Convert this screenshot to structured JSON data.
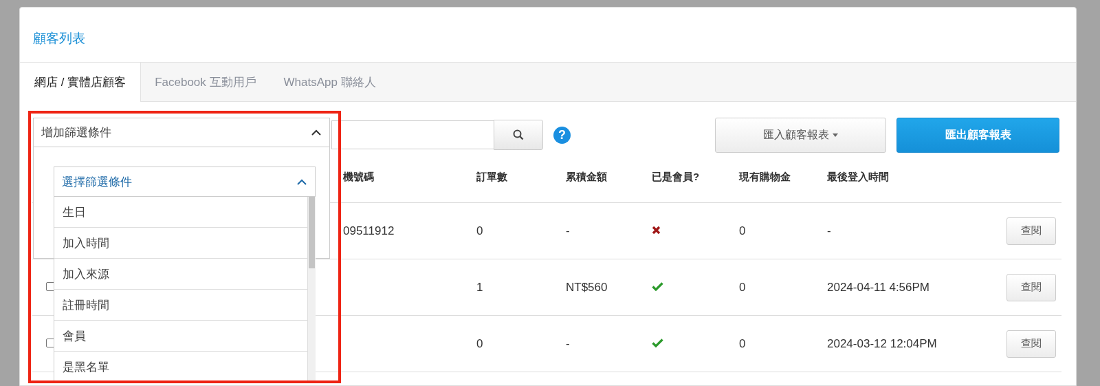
{
  "page_title": "顧客列表",
  "tabs": [
    {
      "label": "網店 / 實體店顧客",
      "selected": true
    },
    {
      "label": "Facebook 互動用戶",
      "selected": false
    },
    {
      "label": "WhatsApp 聯絡人",
      "selected": false
    }
  ],
  "help_icon": "?",
  "import_button": "匯入顧客報表",
  "export_button": "匯出顧客報表",
  "table": {
    "columns": [
      "機號碼",
      "訂單數",
      "累積金額",
      "已是會員?",
      "現有購物金",
      "最後登入時間"
    ],
    "rows": [
      {
        "phone": "09511912",
        "orders": "0",
        "total": "-",
        "member": false,
        "credit": "0",
        "last_login": "-",
        "action": "查閱"
      },
      {
        "checked": false,
        "phone": "",
        "orders": "1",
        "total": "NT$560",
        "member": true,
        "credit": "0",
        "last_login": "2024-04-11 4:56PM",
        "action": "查閱"
      },
      {
        "checked": false,
        "phone": "",
        "orders": "0",
        "total": "-",
        "member": true,
        "credit": "0",
        "last_login": "2024-03-12 12:04PM",
        "action": "查閱"
      }
    ]
  },
  "filter": {
    "label": "增加篩選條件",
    "expanded": true,
    "select": {
      "label": "選擇篩選條件",
      "expanded": true,
      "options": [
        "生日",
        "加入時間",
        "加入來源",
        "註冊時間",
        "會員",
        "是黑名單"
      ]
    }
  }
}
